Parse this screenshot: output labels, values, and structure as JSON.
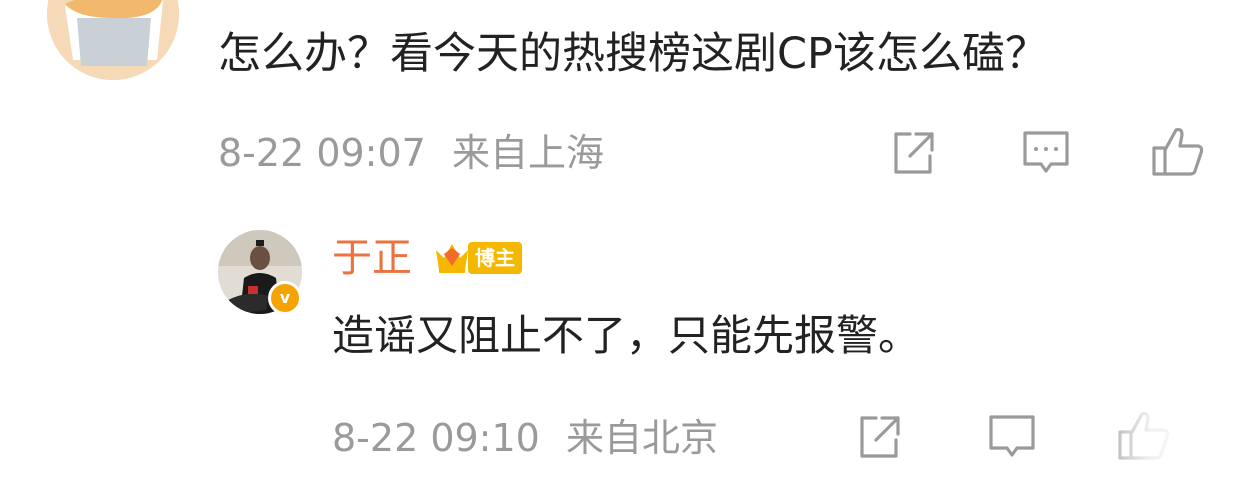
{
  "comment": {
    "text": "怎么办？看今天的热搜榜这剧CP该怎么磕？",
    "date": "8-22 09:07",
    "location": "来自上海",
    "icons": [
      "share-icon",
      "comment-icon",
      "like-icon"
    ]
  },
  "reply": {
    "author": "于正",
    "verified_mark": "v",
    "badge_label": "博主",
    "text": "造谣又阻止不了，只能先报警。",
    "date": "8-22 09:10",
    "location": "来自北京",
    "icons": [
      "share-icon",
      "comment-icon",
      "like-icon"
    ]
  },
  "colors": {
    "author_name": "#eb7340",
    "badge": "#f5b800",
    "meta_text": "#9a9a9a",
    "icon_stroke": "#9a9a9a"
  }
}
